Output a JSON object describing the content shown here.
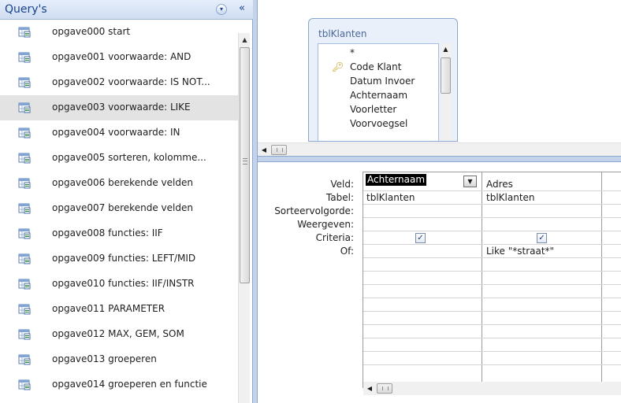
{
  "nav": {
    "title": "Query's",
    "dropdown_glyph": "▾",
    "collapse_glyph": "«",
    "items": [
      {
        "label": "opgave000 start"
      },
      {
        "label": "opgave001 voorwaarde: AND"
      },
      {
        "label": "opgave002 voorwaarde: IS NOT..."
      },
      {
        "label": "opgave003 voorwaarde: LIKE"
      },
      {
        "label": "opgave004 voorwaarde: IN"
      },
      {
        "label": "opgave005 sorteren, kolomme..."
      },
      {
        "label": "opgave006 berekende velden"
      },
      {
        "label": "opgave007 berekende velden"
      },
      {
        "label": "opgave008 functies: IIF"
      },
      {
        "label": "opgave009 functies: LEFT/MID"
      },
      {
        "label": "opgave010 functies: IIF/INSTR"
      },
      {
        "label": "opgave011 PARAMETER"
      },
      {
        "label": "opgave012 MAX, GEM, SOM"
      },
      {
        "label": "opgave013 groeperen"
      },
      {
        "label": "opgave014 groeperen en functie"
      }
    ],
    "selected_index": 3
  },
  "table_window": {
    "title": "tblKlanten",
    "fields": [
      "*",
      "Code Klant",
      "Datum Invoer",
      "Achternaam",
      "Voorletter",
      "Voorvoegsel"
    ],
    "primary_key_icon": "key-icon"
  },
  "grid": {
    "row_labels": [
      "Veld:",
      "Tabel:",
      "Sorteervolgorde:",
      "Weergeven:",
      "Criteria:",
      "Of:"
    ],
    "columns": [
      {
        "veld": "Achternaam",
        "tabel": "tblKlanten",
        "weergeven": true,
        "criteria": ""
      },
      {
        "veld": "Adres",
        "tabel": "tblKlanten",
        "weergeven": true,
        "criteria": "Like \"*straat*\""
      }
    ]
  },
  "colors": {
    "accent": "#15428b",
    "pane_border": "#8aa7cf",
    "selected_row": "#e3e3e3"
  }
}
